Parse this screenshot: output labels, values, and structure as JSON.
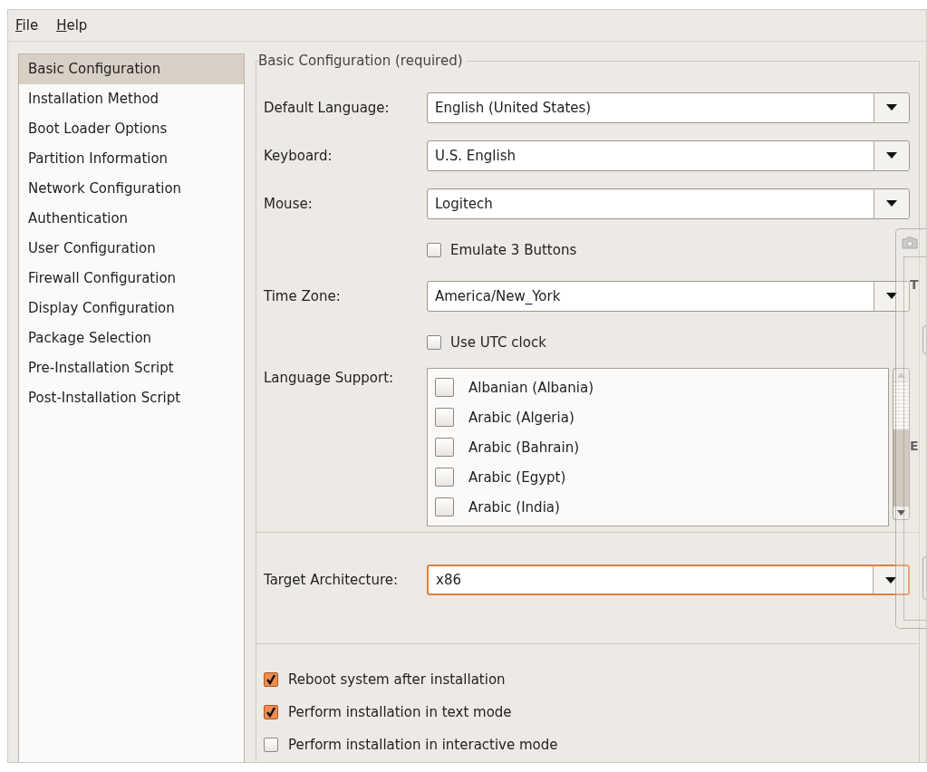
{
  "menu": [
    {
      "label": "File"
    },
    {
      "label": "Help"
    }
  ],
  "sidebar": {
    "items": [
      {
        "label": "Basic Configuration",
        "selected": true
      },
      {
        "label": "Installation Method",
        "selected": false
      },
      {
        "label": "Boot Loader Options",
        "selected": false
      },
      {
        "label": "Partition Information",
        "selected": false
      },
      {
        "label": "Network Configuration",
        "selected": false
      },
      {
        "label": "Authentication",
        "selected": false
      },
      {
        "label": "User Configuration",
        "selected": false
      },
      {
        "label": "Firewall Configuration",
        "selected": false
      },
      {
        "label": "Display Configuration",
        "selected": false
      },
      {
        "label": "Package Selection",
        "selected": false
      },
      {
        "label": "Pre-Installation Script",
        "selected": false
      },
      {
        "label": "Post-Installation Script",
        "selected": false
      }
    ]
  },
  "group": {
    "title": "Basic Configuration (required)",
    "rows": [
      {
        "kind": "combo",
        "label": "Default Language:",
        "value": "English (United States)"
      },
      {
        "kind": "combo",
        "label": "Keyboard:",
        "value": "U.S. English"
      },
      {
        "kind": "combo",
        "label": "Mouse:",
        "value": "Logitech"
      },
      {
        "kind": "check",
        "label": "Emulate 3 Buttons",
        "checked": false
      },
      {
        "kind": "combo",
        "label": "Time Zone:",
        "value": "America/New_York"
      },
      {
        "kind": "check",
        "label": "Use UTC clock",
        "checked": false
      }
    ],
    "language_support": {
      "label": "Language Support:",
      "items": [
        {
          "label": "Albanian (Albania)",
          "checked": false
        },
        {
          "label": "Arabic (Algeria)",
          "checked": false
        },
        {
          "label": "Arabic (Bahrain)",
          "checked": false
        },
        {
          "label": "Arabic (Egypt)",
          "checked": false
        },
        {
          "label": "Arabic (India)",
          "checked": false
        }
      ]
    },
    "target_architecture": {
      "label": "Target Architecture:",
      "value": "x86",
      "focused": true
    },
    "options": [
      {
        "label": "Reboot system after installation",
        "checked": true
      },
      {
        "label": "Perform installation in text mode",
        "checked": true
      },
      {
        "label": "Perform installation in interactive mode",
        "checked": false
      }
    ]
  },
  "background_window": {
    "texts": [
      "T",
      "E"
    ]
  }
}
